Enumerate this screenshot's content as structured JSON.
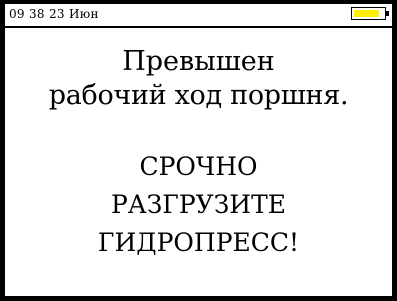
{
  "status_bar": {
    "clock": "09 38 23 Июн",
    "battery_level": 0.85,
    "battery_color": "#ffee00"
  },
  "message": {
    "line1": "Превышен",
    "line2": "рабочий ход поршня.",
    "alert_line1": "СРОЧНО",
    "alert_line2": "РАЗГРУЗИТЕ",
    "alert_line3": "ГИДРОПРЕСС!"
  }
}
